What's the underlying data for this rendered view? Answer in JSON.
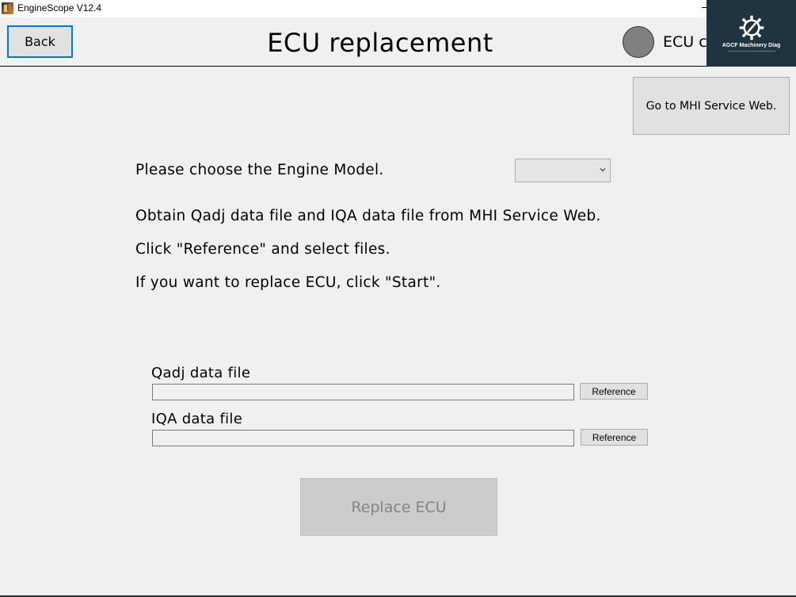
{
  "window": {
    "title": "EngineScope V12.4"
  },
  "header": {
    "back_label": "Back",
    "page_title": "ECU replacement",
    "status_label": "ECU c"
  },
  "watermark": {
    "text": "AGCF Machinery Diag"
  },
  "service_web": {
    "label": "Go to MHI Service Web."
  },
  "instructions": {
    "choose_model": "Please choose the Engine Model.",
    "obtain_files": "Obtain Qadj data file and IQA data file from MHI Service Web.",
    "click_reference": "Click \"Reference\" and select files.",
    "click_start": "If you want to replace ECU, click \"Start\"."
  },
  "engine_model_select": {
    "value": ""
  },
  "files": {
    "qadj": {
      "label": "Qadj data file",
      "value": "",
      "button_label": "Reference"
    },
    "iqa": {
      "label": "IQA data file",
      "value": "",
      "button_label": "Reference"
    }
  },
  "actions": {
    "replace_label": "Replace ECU"
  },
  "colors": {
    "background": "#f0f0f0",
    "focus_border": "#0078d7",
    "status_indicator": "#808080",
    "watermark_bg": "#1f3340",
    "disabled_text": "#838383"
  }
}
